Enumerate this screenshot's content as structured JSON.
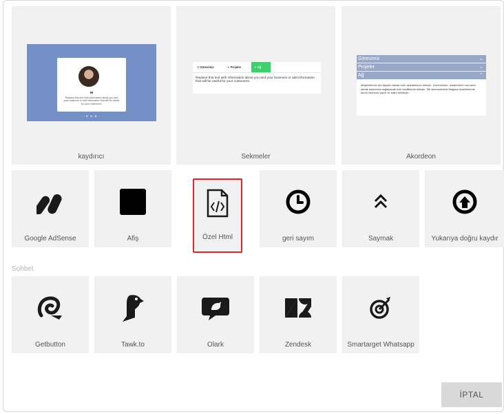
{
  "top_cards": [
    {
      "label": "kaydırıcı",
      "preview": {
        "quote_mark": "❝",
        "text": "Replace this text with information about you and your business or add information that will be useful for your customers.",
        "dots": "● ● ●"
      }
    },
    {
      "label": "Sekmeler",
      "preview": {
        "tabs": [
          "Görevimiz",
          "Projeler",
          "Ağ"
        ],
        "active_tab": "Ağ",
        "body": "Replace this text with information about you and your business or add information that will be useful for your customers."
      }
    },
    {
      "label": "Akordeon",
      "preview": {
        "headers": [
          "Görevimiz",
          "Projeler",
          "Ağ"
        ],
        "body": "Müşterileriniz için faydalı olacak ürün açıklamanızı ekleyin. Ürününüzün, müşterilerin onu satın almak istemesini sağlayacak özel özelliklerini ekleyin. Stil sekmesindeki Mağaza özelliklerinde kendi metninizi yazın ve stilini belirleyin."
      }
    }
  ],
  "widgets": [
    {
      "label": "Google AdSense",
      "icon": "google-adsense-icon"
    },
    {
      "label": "Afiş",
      "icon": "banner-icon"
    },
    {
      "label": "Özel Html",
      "icon": "custom-html-icon",
      "selected": true
    },
    {
      "label": "geri sayım",
      "icon": "countdown-icon"
    },
    {
      "label": "Saymak",
      "icon": "counter-icon"
    },
    {
      "label": "Yukarıya doğru kaydır",
      "icon": "scroll-up-icon"
    }
  ],
  "chat_section": {
    "title": "Sohbet",
    "items": [
      {
        "label": "Getbutton",
        "icon": "getbutton-icon"
      },
      {
        "label": "Tawk.to",
        "icon": "tawkto-icon"
      },
      {
        "label": "Olark",
        "icon": "olark-icon"
      },
      {
        "label": "Zendesk",
        "icon": "zendesk-icon"
      },
      {
        "label": "Smartarget Whatsapp",
        "icon": "smartarget-icon"
      }
    ]
  },
  "buttons": {
    "cancel": "İPTAL"
  },
  "colors": {
    "selected_outline": "#e0262d",
    "tile_bg": "#f1f1f1",
    "active_tab": "#3ecf6f",
    "slider_bg": "#7590c6",
    "accordion_header": "#99a8c6"
  }
}
